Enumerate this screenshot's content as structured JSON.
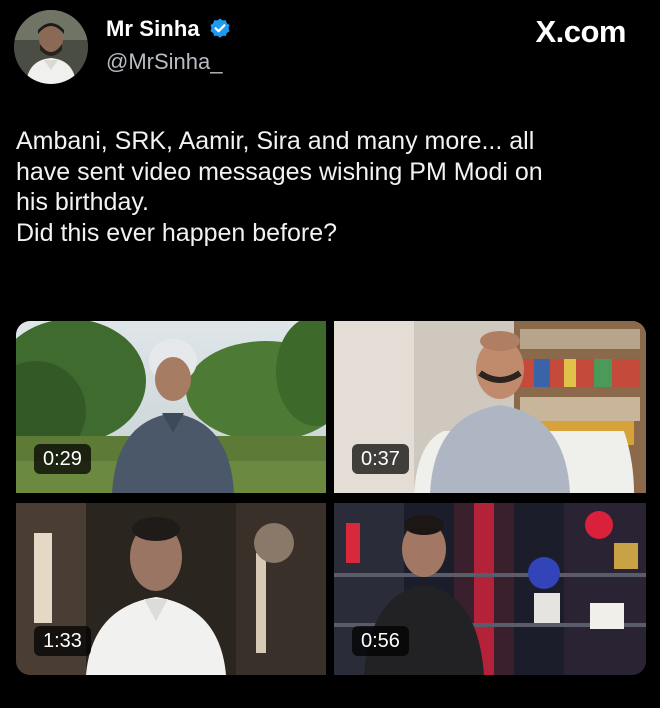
{
  "author": {
    "display_name": "Mr Sinha",
    "handle": "@MrSinha_",
    "verified": true,
    "avatar": "avatar"
  },
  "site_mark": "X.com",
  "tweet": {
    "text": "Ambani, SRK, Aamir, Sira and many more... all\nhave sent video messages wishing PM Modi on\nhis birthday.\nDid this ever happen before?"
  },
  "media": [
    {
      "duration": "0:29"
    },
    {
      "duration": "0:37"
    },
    {
      "duration": "1:33"
    },
    {
      "duration": "0:56"
    }
  ],
  "colors": {
    "background": "#000000",
    "text": "#ffffff",
    "secondary_text": "#b7bcc1",
    "verified_badge": "#1d9bf0"
  }
}
